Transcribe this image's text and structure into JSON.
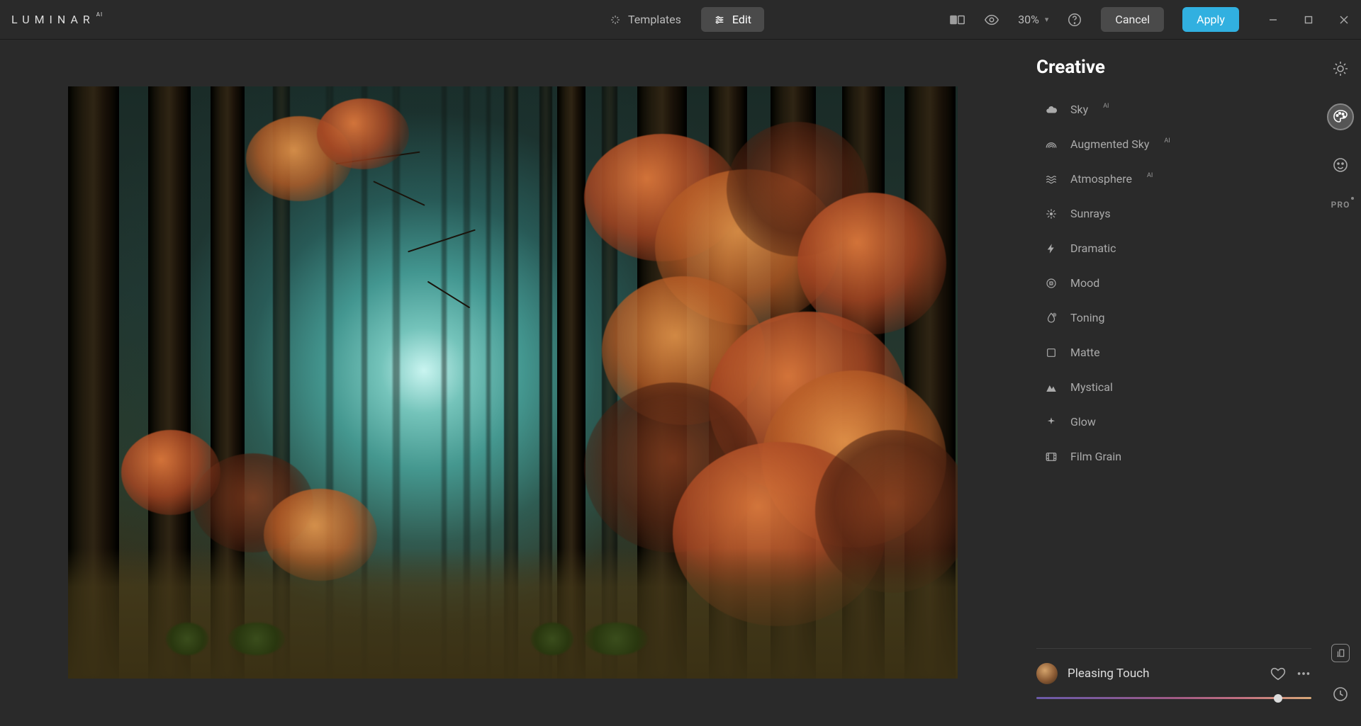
{
  "app": {
    "name": "LUMINAR",
    "suffix": "AI"
  },
  "topbar": {
    "templates_label": "Templates",
    "edit_label": "Edit",
    "zoom": "30%",
    "cancel": "Cancel",
    "apply": "Apply"
  },
  "panel": {
    "title": "Creative",
    "tools": [
      {
        "label": "Sky",
        "ai": "AI",
        "icon": "cloud"
      },
      {
        "label": "Augmented Sky",
        "ai": "AI",
        "icon": "rainbow"
      },
      {
        "label": "Atmosphere",
        "ai": "AI",
        "icon": "waves"
      },
      {
        "label": "Sunrays",
        "ai": "",
        "icon": "sunburst"
      },
      {
        "label": "Dramatic",
        "ai": "",
        "icon": "bolt"
      },
      {
        "label": "Mood",
        "ai": "",
        "icon": "mood"
      },
      {
        "label": "Toning",
        "ai": "",
        "icon": "drop"
      },
      {
        "label": "Matte",
        "ai": "",
        "icon": "square"
      },
      {
        "label": "Mystical",
        "ai": "",
        "icon": "mountain"
      },
      {
        "label": "Glow",
        "ai": "",
        "icon": "sparkle"
      },
      {
        "label": "Film Grain",
        "ai": "",
        "icon": "film"
      }
    ]
  },
  "preset": {
    "name": "Pleasing Touch",
    "slider_pct": 88
  },
  "rail": {
    "pro": "PRO"
  }
}
